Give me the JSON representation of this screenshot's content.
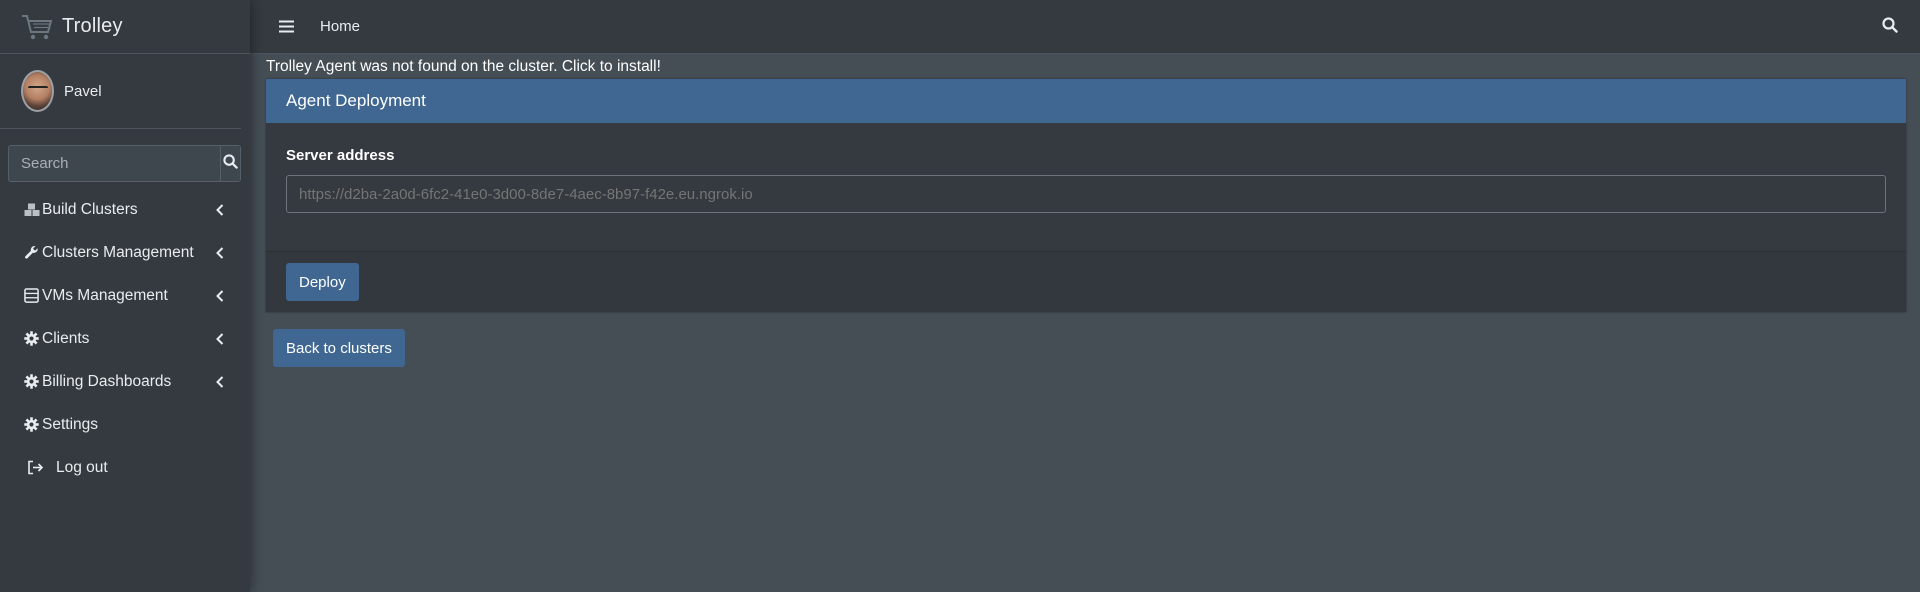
{
  "brand": {
    "name": "Trolley",
    "icon": "cart-icon"
  },
  "user": {
    "name": "Pavel"
  },
  "search": {
    "placeholder": "Search",
    "value": ""
  },
  "sidebar": {
    "items": [
      {
        "label": "Build Clusters",
        "icon": "cubes-icon",
        "has_children": true
      },
      {
        "label": "Clusters Management",
        "icon": "wrench-icon",
        "has_children": true
      },
      {
        "label": "VMs Management",
        "icon": "server-icon",
        "has_children": true
      },
      {
        "label": "Clients",
        "icon": "gear-icon",
        "has_children": true
      },
      {
        "label": "Billing Dashboards",
        "icon": "gear-icon",
        "has_children": true
      },
      {
        "label": "Settings",
        "icon": "gear-icon",
        "has_children": false
      },
      {
        "label": "Log out",
        "icon": "sign-out-icon",
        "has_children": false
      }
    ]
  },
  "topbar": {
    "home_label": "Home"
  },
  "alert": {
    "text": "Trolley Agent was not found on the cluster. Click to install!"
  },
  "card": {
    "title": "Agent Deployment",
    "field_label": "Server address",
    "field_placeholder": "https://d2ba-2a0d-6fc2-41e0-3d00-8de7-4aec-8b97-f42e.eu.ngrok.io",
    "deploy_label": "Deploy"
  },
  "back_label": "Back to clusters",
  "colors": {
    "accent": "#3f6791",
    "sidebar_bg": "#343a40",
    "content_bg": "#454d55"
  }
}
